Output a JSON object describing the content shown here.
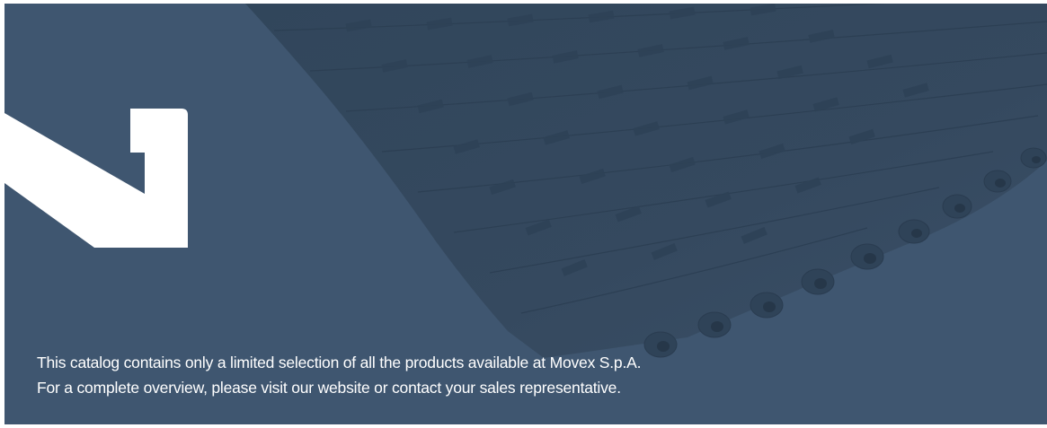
{
  "colors": {
    "background": "#3f5670",
    "belt": "#34495f",
    "belt_shade": "#2d4055",
    "text": "#ffffff",
    "logo": "#ffffff"
  },
  "icons": {
    "logo": "movex-logo-mark-icon",
    "belt": "modular-conveyor-belt-image"
  },
  "notice": {
    "line1": "This catalog contains only a limited selection of all the products available at Movex S.p.A.",
    "line2": "For a complete overview, please visit our website or contact your sales representative."
  }
}
